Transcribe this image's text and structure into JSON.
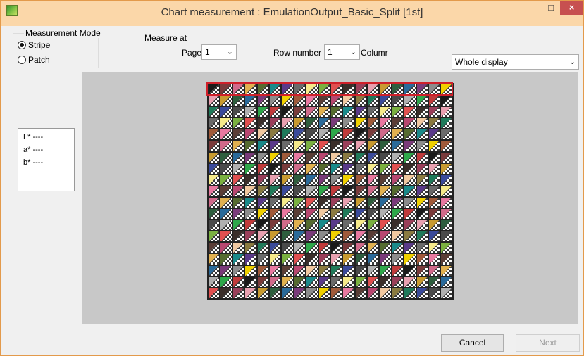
{
  "window": {
    "title": "Chart measurement : EmulationOutput_Basic_Split [1st]",
    "controls": {
      "minimize": "–",
      "maximize": "□",
      "close": "×"
    }
  },
  "measurement_mode": {
    "label": "Measurement Mode",
    "options": [
      {
        "label": "Stripe",
        "selected": true
      },
      {
        "label": "Patch",
        "selected": false
      }
    ]
  },
  "measure_at": {
    "label": "Measure at",
    "page_label": "Page",
    "page_value": "1",
    "row_label": "Row number",
    "row_value": "1",
    "column_label": "Columr"
  },
  "display_select": {
    "value": "Whole display"
  },
  "lab_values": {
    "l": "L* ----",
    "a": "a* ----",
    "b": "b* ----"
  },
  "chart": {
    "columns": 20,
    "rows": 19,
    "highlighted_row": 1,
    "palette": [
      "#1a1a1a",
      "#3a2e2a",
      "#5a3d36",
      "#7a3b3b",
      "#9a3f5a",
      "#b84770",
      "#d06a8a",
      "#e8a0b0",
      "#f0c8a0",
      "#e0b050",
      "#c89a30",
      "#8a7a40",
      "#556b2f",
      "#2e5e3e",
      "#1f7a5a",
      "#1a8a8a",
      "#2a6a9a",
      "#3a4a9a",
      "#5a3a8a",
      "#7a3a7a",
      "#4a4a4a",
      "#6a6a6a",
      "#8c8c8c",
      "#b0b0b0",
      "#f5e98a",
      "#f0d000",
      "#2ea84a",
      "#7ab040",
      "#a05a3a",
      "#c03a3a",
      "#e05050",
      "#e878a0"
    ]
  },
  "buttons": {
    "cancel": "Cancel",
    "next": "Next"
  },
  "colors": {
    "title_bar": "#fbd7a9",
    "highlight": "#d0202a",
    "close": "#c75050"
  }
}
